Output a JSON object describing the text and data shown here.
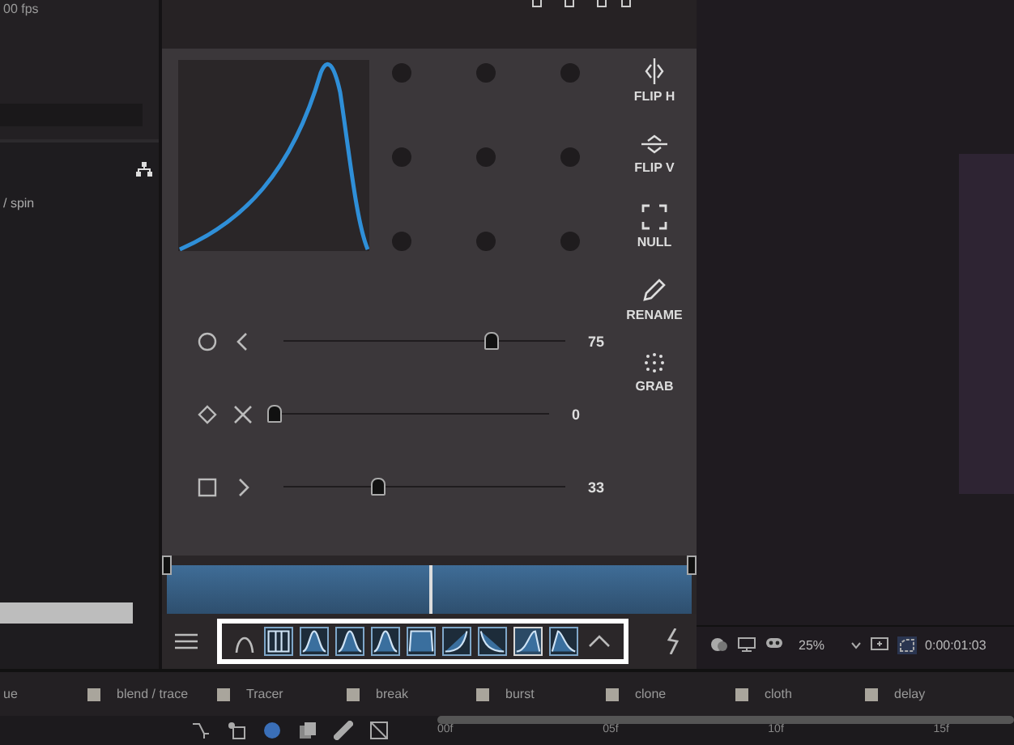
{
  "left_panel": {
    "frame_rate": "00 fps",
    "layer_label": "/ spin"
  },
  "panel": {
    "sliders": [
      {
        "kind": "circle",
        "level": 0.75,
        "reading": "75"
      },
      {
        "kind": "cross",
        "level": 0,
        "reading": "0"
      },
      {
        "kind": "square",
        "level": 0.33,
        "reading": "33"
      }
    ],
    "tools": [
      {
        "kind": "flip-h",
        "label": "FLIP H"
      },
      {
        "kind": "flip-v",
        "label": "FLIP V"
      },
      {
        "kind": "null",
        "label": "NULL"
      },
      {
        "kind": "rename",
        "label": "RENAME"
      },
      {
        "kind": "grab",
        "label": "GRAB"
      }
    ],
    "presets": [
      {
        "kind": "linear",
        "selected": false
      },
      {
        "kind": "bell",
        "selected": false
      },
      {
        "kind": "bell",
        "selected": false
      },
      {
        "kind": "bell",
        "selected": false
      },
      {
        "kind": "square",
        "selected": false
      },
      {
        "kind": "ease-in",
        "selected": false
      },
      {
        "kind": "ease-out",
        "selected": false
      },
      {
        "kind": "ramp",
        "selected": true
      },
      {
        "kind": "decay",
        "selected": false
      }
    ]
  },
  "viewer": {
    "zoom": "25%",
    "timecode": "0:00:01:03"
  },
  "labels": [
    "ue",
    "blend / trace",
    "Tracer",
    "break",
    "burst",
    "clone",
    "cloth",
    "delay"
  ],
  "ruler": [
    "00f",
    "05f",
    "10f",
    "15f"
  ]
}
